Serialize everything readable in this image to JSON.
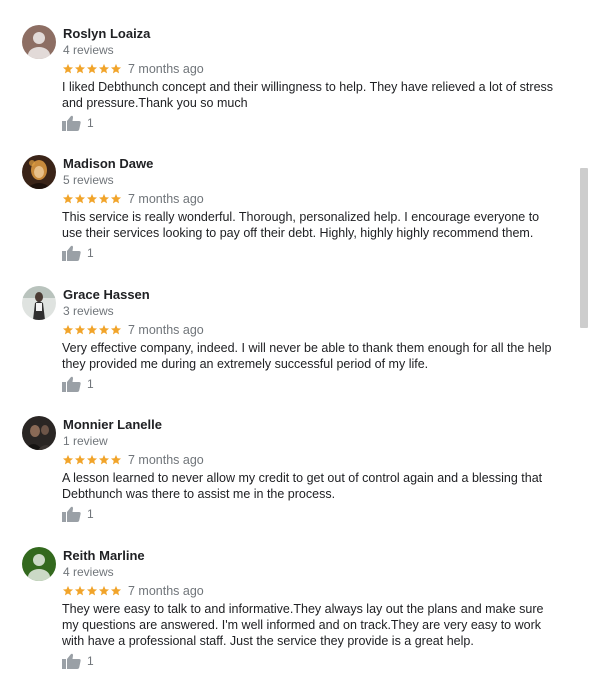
{
  "colors": {
    "star": "#f1a42a",
    "muted": "#70757a",
    "text": "#202124",
    "icon": "#9aa0a6"
  },
  "reviews": [
    {
      "author": "Roslyn Loaiza",
      "review_count": "4 reviews",
      "rating": 5,
      "time": "7 months ago",
      "text": "I liked Debthunch concept and their willingness to help. They have relieved a lot of stress and pressure.Thank you so much",
      "likes": "1",
      "avatar": "default-person-brown"
    },
    {
      "author": "Madison Dawe",
      "review_count": "5 reviews",
      "rating": 5,
      "time": "7 months ago",
      "text": "This service is really wonderful. Thorough, personalized help. I encourage everyone to use their services looking to pay off their debt. Highly, highly highly recommend them.",
      "likes": "1",
      "avatar": "photo"
    },
    {
      "author": "Grace Hassen",
      "review_count": "3 reviews",
      "rating": 5,
      "time": "7 months ago",
      "text": "Very effective company, indeed. I will never be able to thank them enough for all the help they provided me during an extremely successful period of my life.",
      "likes": "1",
      "avatar": "photo"
    },
    {
      "author": "Monnier Lanelle",
      "review_count": "1 review",
      "rating": 5,
      "time": "7 months ago",
      "text": "A lesson learned to never allow my credit to get out of control again and a blessing that Debthunch was there to assist me in the process.",
      "likes": "1",
      "avatar": "photo"
    },
    {
      "author": "Reith Marline",
      "review_count": "4 reviews",
      "rating": 5,
      "time": "7 months ago",
      "text": "They were easy to talk to and informative.They always lay out the plans and make sure my questions are answered. I'm well informed and on track.They are very easy to work with have a professional staff. Just the service they provide is a great help.",
      "likes": "1",
      "avatar": "default-person-green"
    }
  ]
}
